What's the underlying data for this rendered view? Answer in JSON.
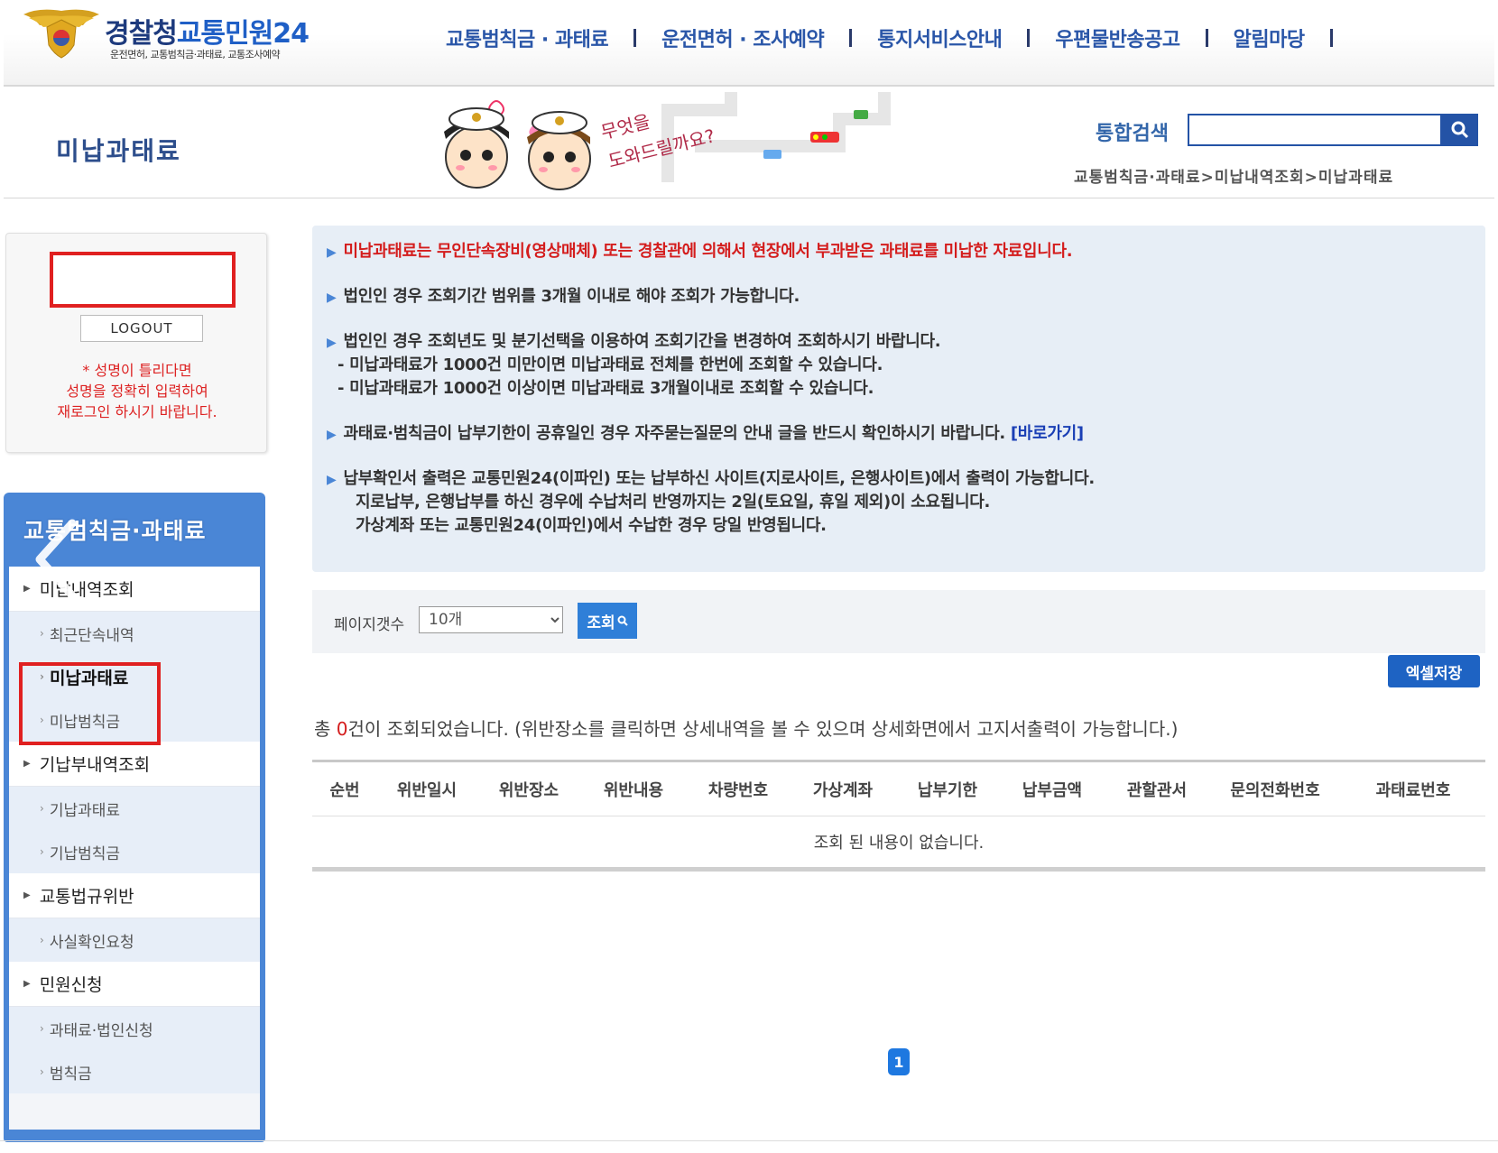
{
  "header": {
    "logo_title_a": "경찰청",
    "logo_title_b": "교통민원24",
    "logo_sub": "운전면허, 교통범칙금·과태료, 교통조사예약",
    "nav": [
      "교통범칙금 · 과태료",
      "운전면허 · 조사예약",
      "통지서비스안내",
      "우편물반송공고",
      "알림마당"
    ]
  },
  "subheader": {
    "page_title": "미납과태료",
    "mascot_text_1": "무엇을",
    "mascot_text_2": "도와드릴까요?",
    "search_label": "통합검색",
    "search_value": "",
    "breadcrumb": "교통범칙금·과태료>미납내역조회>미납과태료"
  },
  "login": {
    "logout_label": "LOGOUT",
    "note_line1": "* 성명이 틀리다면",
    "note_line2": "성명을 정확히 입력하여",
    "note_line3": "재로그인 하시기 바랍니다."
  },
  "lnb": {
    "title": "교통범칙금·과태료",
    "items": [
      {
        "type": "cat",
        "label": "미납내역조회"
      },
      {
        "type": "sub",
        "label": "최근단속내역"
      },
      {
        "type": "sub",
        "label": "미납과태료",
        "active": true
      },
      {
        "type": "sub",
        "label": "미납범칙금"
      },
      {
        "type": "cat",
        "label": "기납부내역조회"
      },
      {
        "type": "sub",
        "label": "기납과태료"
      },
      {
        "type": "sub",
        "label": "기납범칙금"
      },
      {
        "type": "cat",
        "label": "교통법규위반"
      },
      {
        "type": "sub",
        "label": "사실확인요청"
      },
      {
        "type": "cat",
        "label": "민원신청"
      },
      {
        "type": "sub",
        "label": "과태료·법인신청"
      },
      {
        "type": "sub",
        "label": "범칙금"
      }
    ]
  },
  "notice": {
    "line1": "미납과태료는 무인단속장비(영상매체) 또는 경찰관에 의해서 현장에서 부과받은 과태료를 미납한 자료입니다.",
    "line2": "법인인 경우 조회기간 범위를 3개월 이내로 해야 조회가 가능합니다.",
    "line3": "법인인 경우 조회년도 및 분기선택을 이용하여 조회기간을 변경하여 조회하시기 바랍니다.",
    "line3a": "- 미납과태료가 1000건 미만이면 미납과태료 전체를 한번에 조회할 수 있습니다.",
    "line3b": "- 미납과태료가 1000건 이상이면 미납과태료 3개월이내로 조회할 수 있습니다.",
    "line4": "과태료·범칙금이 납부기한이 공휴일인 경우 자주묻는질문의 안내 글을 반드시 확인하시기 바랍니다.",
    "line4_link": "[바로가기]",
    "line5": "납부확인서 출력은 교통민원24(이파인) 또는 납부하신 사이트(지로사이트, 은행사이트)에서 출력이 가능합니다.",
    "line5a": "지로납부, 은행납부를 하신 경우에 수납처리 반영까지는 2일(토요일, 휴일 제외)이 소요됩니다.",
    "line5b": "가상계좌 또는 교통민원24(이파인)에서 수납한 경우 당일 반영됩니다."
  },
  "filter": {
    "label": "페이지갯수",
    "selected": "10개",
    "search_button": "조회"
  },
  "excel_button": "엑셀저장",
  "summary": {
    "prefix": "총 ",
    "count": "0",
    "suffix": "건이 조회되었습니다. (위반장소를 클릭하면 상세내역을 볼 수 있으며 상세화면에서 고지서출력이 가능합니다.)"
  },
  "table": {
    "headers": [
      "순번",
      "위반일시",
      "위반장소",
      "위반내용",
      "차량번호",
      "가상계좌",
      "납부기한",
      "납부금액",
      "관할관서",
      "문의전화번호",
      "과태료번호"
    ],
    "empty_text": "조회 된 내용이 없습니다."
  },
  "pagination": {
    "current": "1"
  },
  "colors": {
    "brand_blue": "#2a56a8",
    "lnb_blue": "#4a86d6",
    "alert_red": "#d41d1d",
    "highlight_red": "#e02020"
  }
}
